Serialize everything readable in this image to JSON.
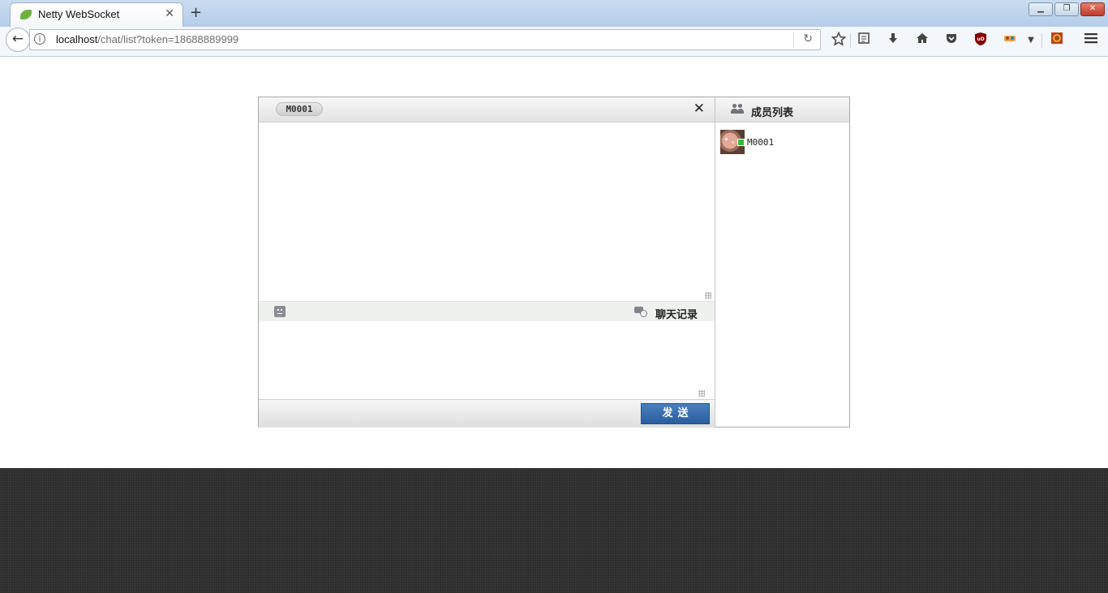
{
  "browser": {
    "tab_title": "Netty WebSocket",
    "tab_close": "✕",
    "new_tab": "+",
    "window_controls": {
      "minimize": "▁",
      "maximize": "❐",
      "close": "✕"
    },
    "url_host": "localhost",
    "url_path": "/chat/list?token=18688889999",
    "info_glyph": "i",
    "back_glyph": "←",
    "reload_glyph": "↻",
    "toolbar_icons": [
      "star-icon",
      "reader-icon",
      "download-icon",
      "home-icon",
      "pocket-icon",
      "ublock-icon",
      "extension-icon",
      "menu-dropdown-icon",
      "addon-icon",
      "hamburger-menu-icon"
    ]
  },
  "chat": {
    "session_tab": "M0001",
    "close_glyph": "✕",
    "history_label": "聊天记录",
    "send_label": "发送",
    "message_text": "",
    "input_value": ""
  },
  "members": {
    "title": "成员列表",
    "items": [
      {
        "name": "M0001",
        "status": "online",
        "status_color": "#2fbf2f"
      }
    ]
  },
  "colors": {
    "send_button": "#2a5f9e",
    "footer": "#2c2c2c",
    "online": "#2fbf2f"
  }
}
